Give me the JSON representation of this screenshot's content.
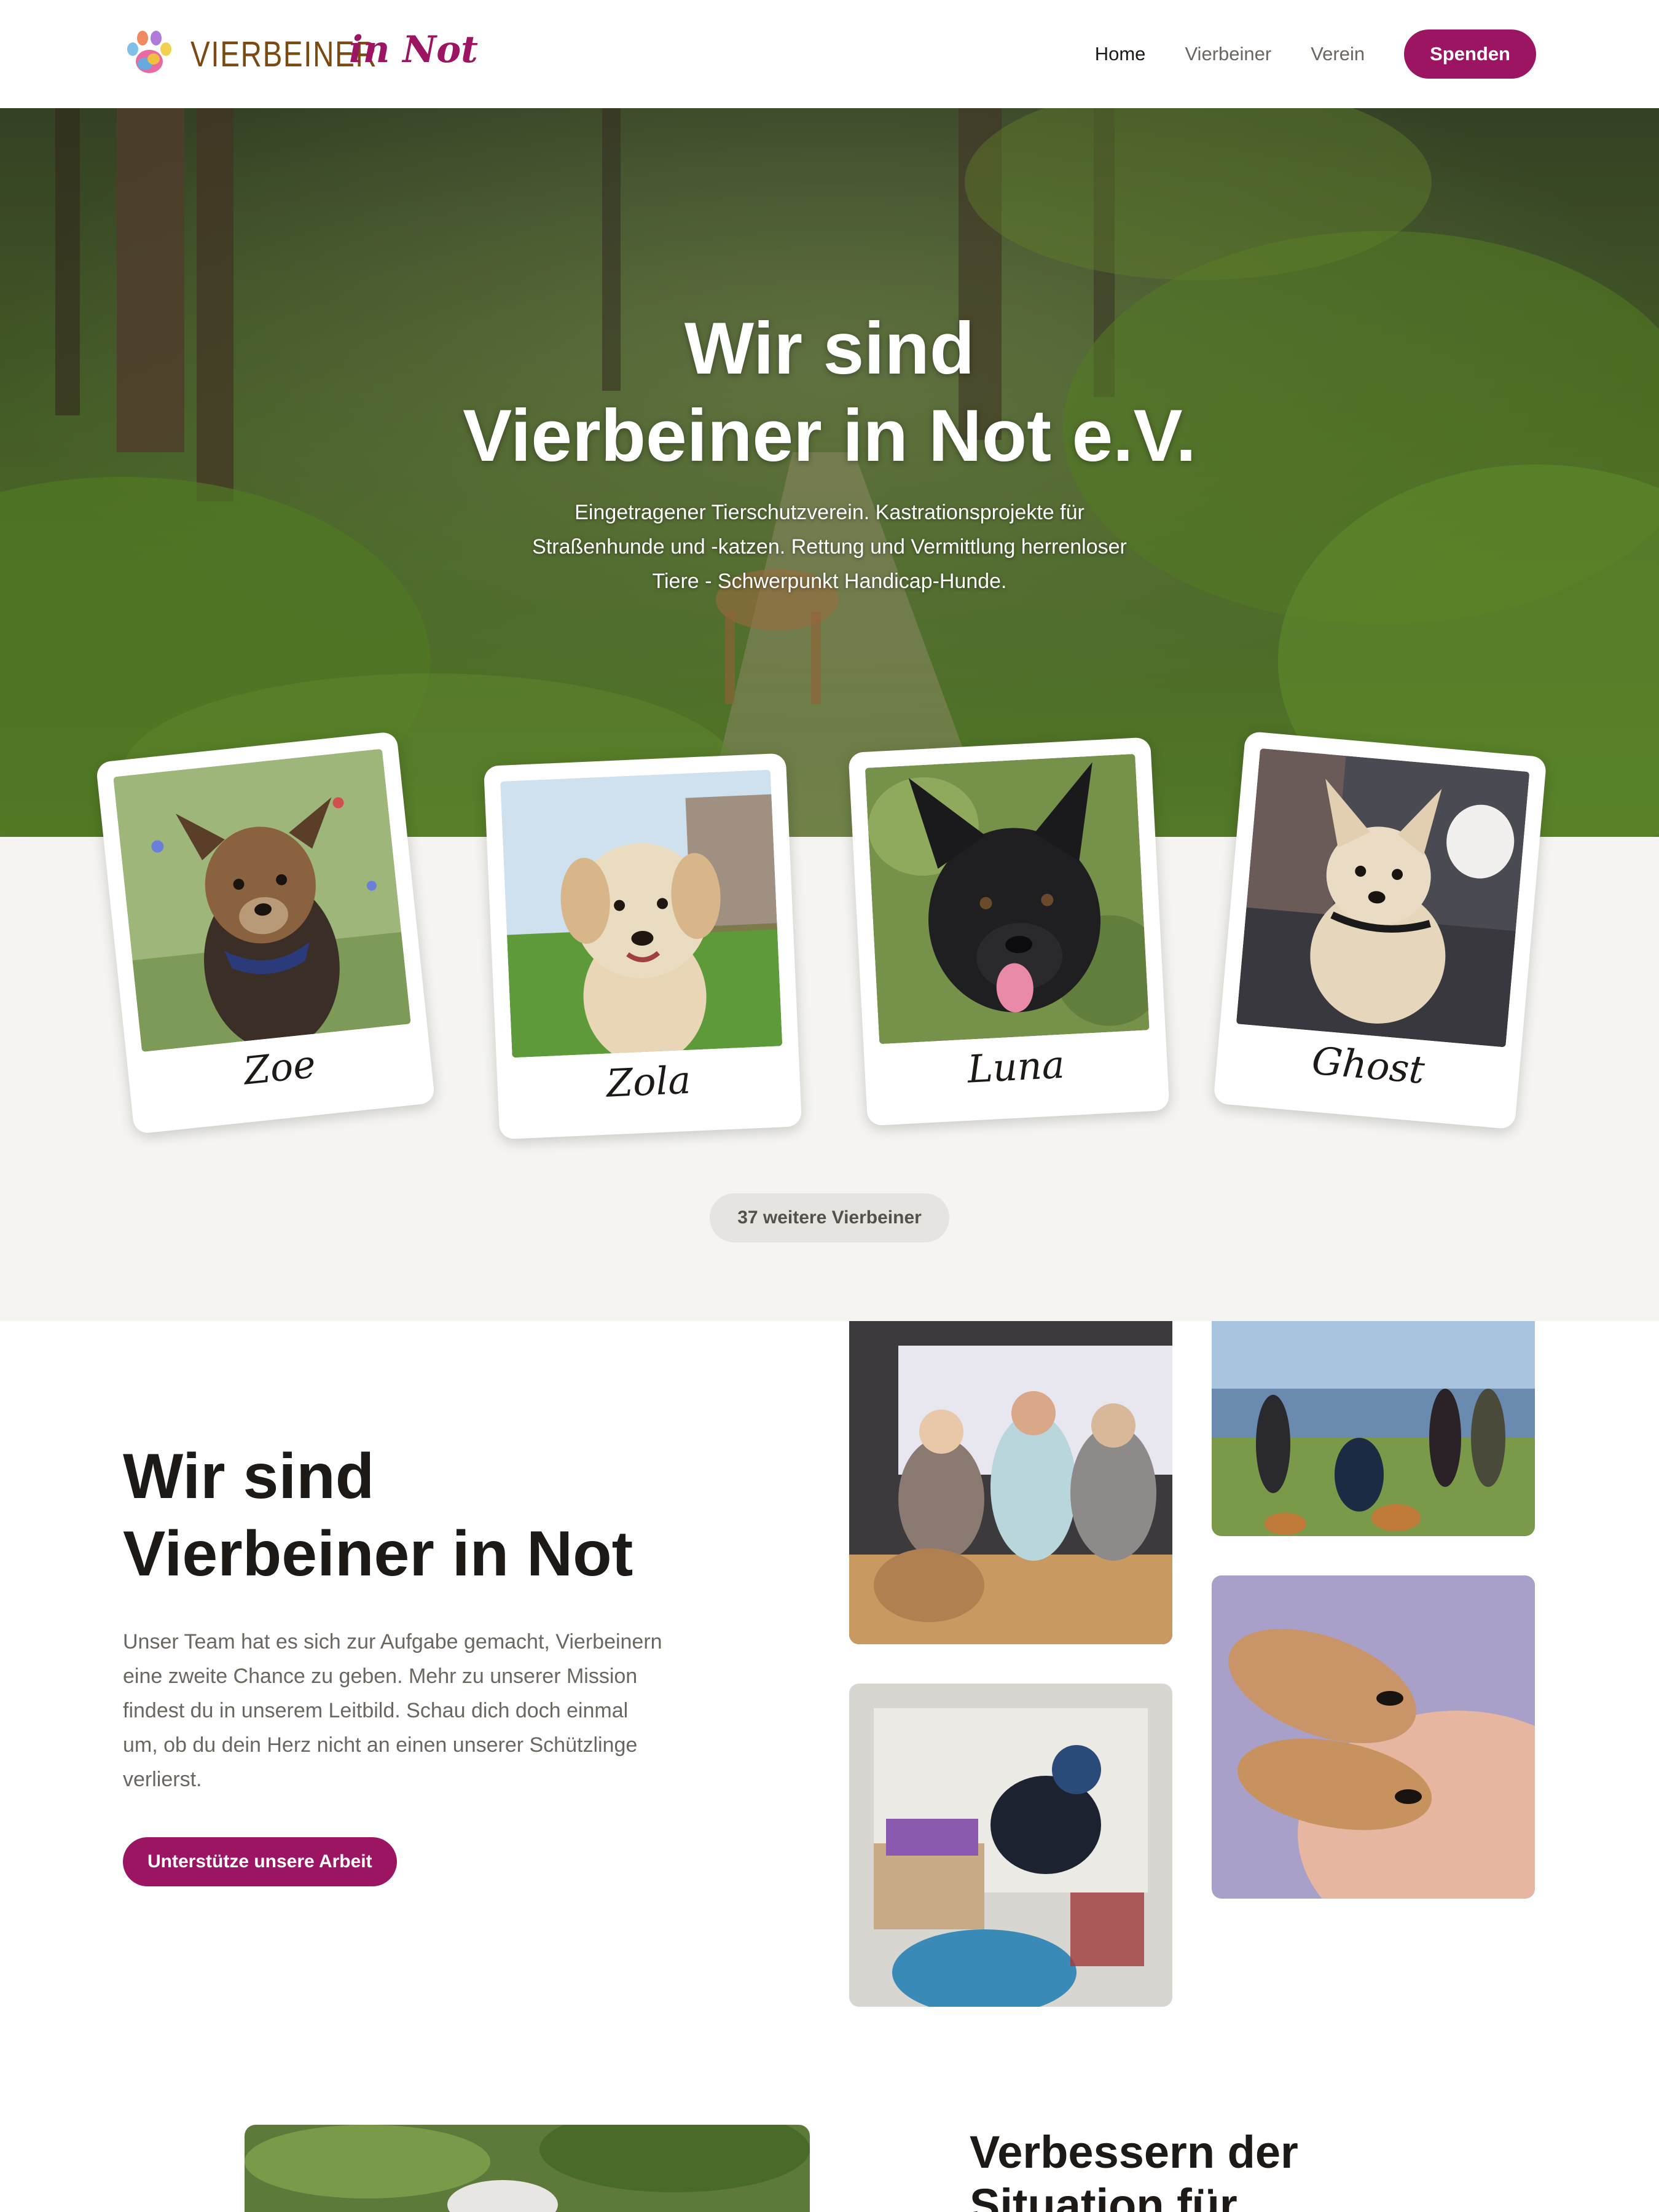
{
  "header": {
    "logo_text": "VIERBEINER",
    "logo_script": "in Not",
    "logo_icon": "paw-icon",
    "nav": [
      {
        "label": "Home",
        "active": true
      },
      {
        "label": "Vierbeiner",
        "active": false
      },
      {
        "label": "Verein",
        "active": false
      }
    ],
    "donate_label": "Spenden"
  },
  "hero": {
    "title_line1": "Wir sind",
    "title_line2": "Vierbeiner in Not e.V.",
    "subtitle_line1": "Eingetragener Tierschutzverein. Kastrationsprojekte für",
    "subtitle_line2": "Straßenhunde und -katzen. Rettung und Vermittlung herrenloser",
    "subtitle_line3": "Tiere - Schwerpunkt Handicap-Hunde."
  },
  "animals": [
    {
      "name": "Zoe"
    },
    {
      "name": "Zola"
    },
    {
      "name": "Luna"
    },
    {
      "name": "Ghost"
    }
  ],
  "more_animals_label": "37 weitere Vierbeiner",
  "about": {
    "title_line1": "Wir sind",
    "title_line2": "Vierbeiner in Not",
    "text": "Unser Team hat es sich zur Aufgabe gemacht, Vierbeinern eine zweite Chance zu geben. Mehr zu unserer Mission findest du in unserem Leitbild. Schau dich doch einmal um, ob du dein Herz nicht an einen unserer Schützlinge verlierst.",
    "button_label": "Unterstütze unsere Arbeit"
  },
  "next_section": {
    "title_line1": "Verbessern der",
    "title_line2": "Situation für"
  },
  "colors": {
    "brand": "#9c1563",
    "logo_brown": "#7a4a10",
    "band_bg": "#f5f4f0",
    "text_muted": "#6b6660"
  }
}
